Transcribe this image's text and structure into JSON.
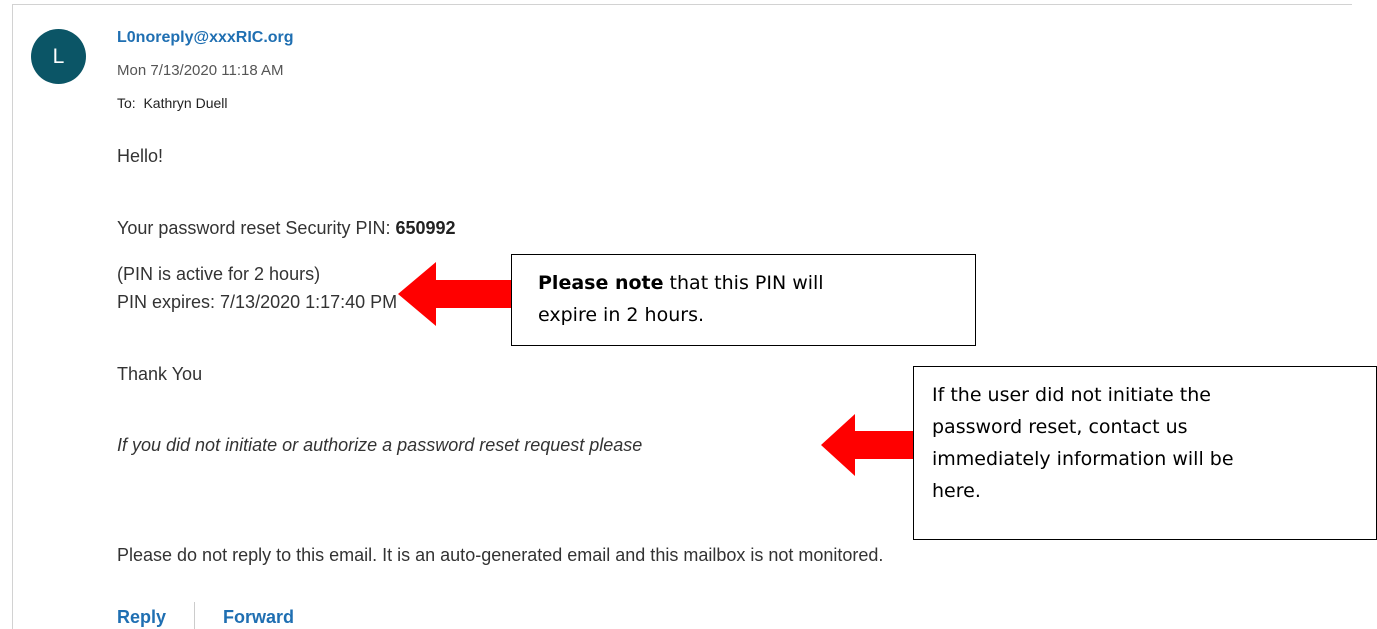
{
  "email": {
    "avatar_initial": "L",
    "sender": "L0noreply@xxxRIC.org",
    "date": "Mon 7/13/2020 11:18 AM",
    "to_label": "To:",
    "to_name": "Kathryn Duell",
    "greeting": "Hello!",
    "pin_prefix": "Your password reset Security PIN: ",
    "pin": "650992",
    "pin_active": "(PIN is active for 2 hours)",
    "pin_expires": "PIN expires: 7/13/2020 1:17:40 PM",
    "thanks": "Thank You",
    "warning": "If you did not initiate or authorize a password reset request please",
    "footer": "Please do not reply to this email. It is an auto-generated email and this mailbox is not monitored."
  },
  "actions": {
    "reply": "Reply",
    "forward": "Forward"
  },
  "annotations": {
    "note1_bold": "Please note",
    "note1_rest": " that this PIN will",
    "note1_line2": "expire in 2 hours.",
    "note2_lines": [
      "If the user did not initiate the",
      "password reset, contact us",
      "immediately information will be",
      "here."
    ],
    "arrow_color": "#ff0000"
  },
  "colors": {
    "avatar": "#0b5566",
    "link": "#1f6fb2"
  }
}
